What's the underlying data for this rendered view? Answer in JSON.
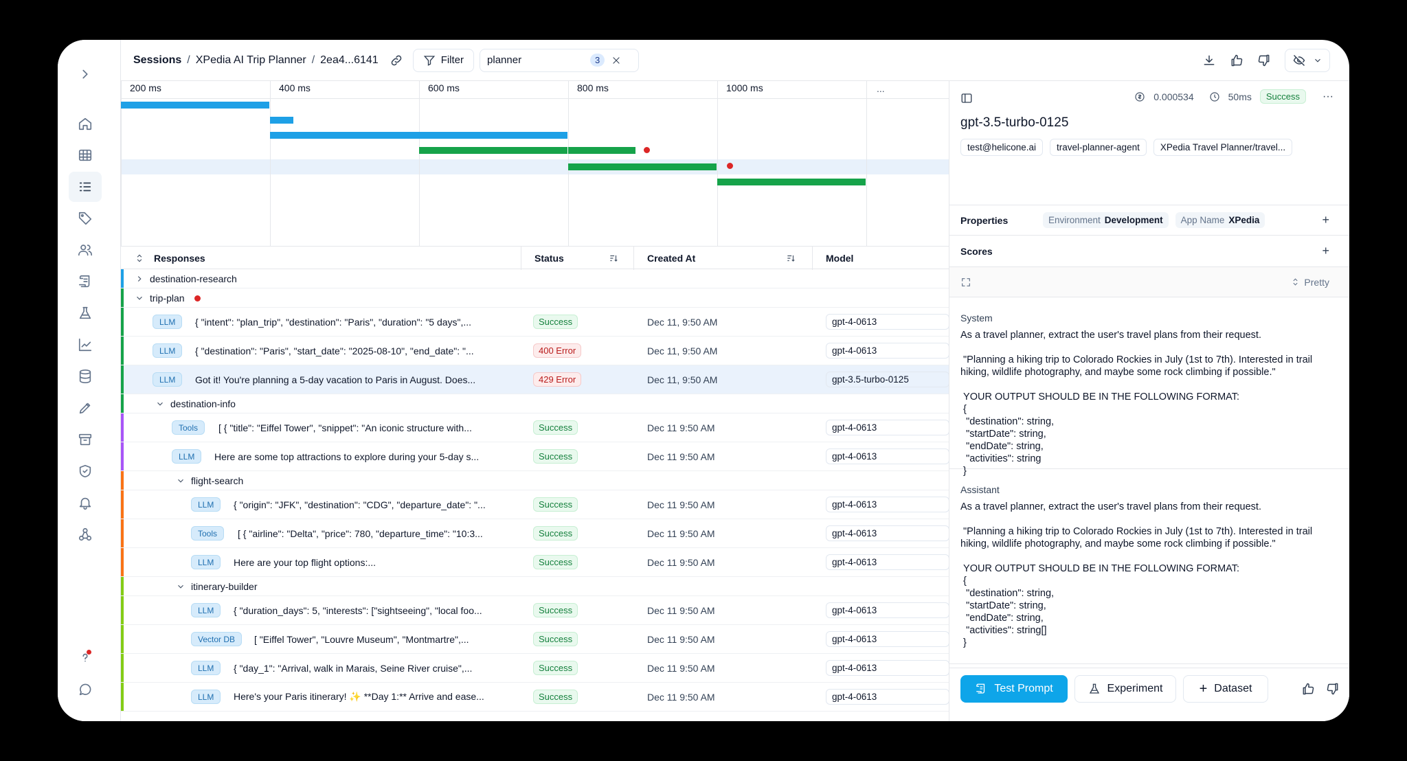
{
  "breadcrumb": {
    "sessions": "Sessions",
    "session_name": "XPedia AI Trip Planner",
    "session_id": "2ea4...6141"
  },
  "toolbar": {
    "filter_label": "Filter",
    "search_value": "planner",
    "search_count": "3"
  },
  "timeline": {
    "ticks": [
      "200 ms",
      "400 ms",
      "600 ms",
      "800 ms",
      "1000 ms"
    ],
    "more": "..."
  },
  "table": {
    "headers": {
      "responses": "Responses",
      "status": "Status",
      "created_at": "Created At",
      "model": "Model"
    },
    "groups": {
      "destination_research": "destination-research",
      "trip_plan": "trip-plan",
      "destination_info": "destination-info",
      "flight_search": "flight-search",
      "itinerary_builder": "itinerary-builder"
    },
    "rows": [
      {
        "type": "LLM",
        "response": "{ \"intent\": \"plan_trip\", \"destination\": \"Paris\", \"duration\": \"5 days\",...",
        "status": "Success",
        "created": "Dec 11, 9:50 AM",
        "model": "gpt-4-0613"
      },
      {
        "type": "LLM",
        "response": "{ \"destination\": \"Paris\", \"start_date\": \"2025-08-10\", \"end_date\": \"...",
        "status": "400 Error",
        "created": "Dec 11, 9:50 AM",
        "model": "gpt-4-0613"
      },
      {
        "type": "LLM",
        "response": "Got it! You're planning a 5-day vacation to Paris in August. Does...",
        "status": "429 Error",
        "created": "Dec 11, 9:50 AM",
        "model": "gpt-3.5-turbo-0125"
      },
      {
        "type": "Tools",
        "response": "[ { \"title\": \"Eiffel Tower\", \"snippet\": \"An iconic structure with...",
        "status": "Success",
        "created": "Dec 11 9:50 AM",
        "model": "gpt-4-0613"
      },
      {
        "type": "LLM",
        "response": "Here are some top attractions to explore during your 5-day s...",
        "status": "Success",
        "created": "Dec 11 9:50 AM",
        "model": "gpt-4-0613"
      },
      {
        "type": "LLM",
        "response": "{ \"origin\": \"JFK\", \"destination\": \"CDG\", \"departure_date\": \"...",
        "status": "Success",
        "created": "Dec 11 9:50 AM",
        "model": "gpt-4-0613"
      },
      {
        "type": "Tools",
        "response": "[ { \"airline\": \"Delta\", \"price\": 780, \"departure_time\": \"10:3...",
        "status": "Success",
        "created": "Dec 11 9:50 AM",
        "model": "gpt-4-0613"
      },
      {
        "type": "LLM",
        "response": "Here are your top flight options:...",
        "status": "Success",
        "created": "Dec 11 9:50 AM",
        "model": "gpt-4-0613"
      },
      {
        "type": "LLM",
        "response": "{ \"duration_days\": 5, \"interests\": [\"sightseeing\", \"local foo...",
        "status": "Success",
        "created": "Dec 11 9:50 AM",
        "model": "gpt-4-0613"
      },
      {
        "type": "Vector DB",
        "response": "[ \"Eiffel Tower\", \"Louvre Museum\", \"Montmartre\",...",
        "status": "Success",
        "created": "Dec 11 9:50 AM",
        "model": "gpt-4-0613"
      },
      {
        "type": "LLM",
        "response": "{ \"day_1\": \"Arrival, walk in Marais, Seine River cruise\",...",
        "status": "Success",
        "created": "Dec 11 9:50 AM",
        "model": "gpt-4-0613"
      },
      {
        "type": "LLM",
        "response": "Here's your Paris itinerary! ✨ **Day 1:** Arrive and ease...",
        "status": "Success",
        "created": "Dec 11 9:50 AM",
        "model": "gpt-4-0613"
      }
    ]
  },
  "detail": {
    "cost": "0.000534",
    "latency": "50ms",
    "status": "Success",
    "model": "gpt-3.5-turbo-0125",
    "tags": [
      "test@helicone.ai",
      "travel-planner-agent",
      "XPedia Travel Planner/travel..."
    ],
    "properties_label": "Properties",
    "properties": [
      {
        "key": "Environment",
        "value": "Development"
      },
      {
        "key": "App Name",
        "value": "XPedia"
      }
    ],
    "scores_label": "Scores",
    "pretty_label": "Pretty",
    "messages": [
      {
        "role": "System",
        "text": "As a travel planner, extract the user's travel plans from their request.\n\n \"Planning a hiking trip to Colorado Rockies in July (1st to 7th). Interested in trail hiking, wildlife photography, and maybe some rock climbing if possible.\"\n\n YOUR OUTPUT SHOULD BE IN THE FOLLOWING FORMAT:\n {\n  \"destination\": string,\n  \"startDate\": string,\n  \"endDate\": string,\n  \"activities\": string\n }"
      },
      {
        "role": "Assistant",
        "text": "As a travel planner, extract the user's travel plans from their request.\n\n \"Planning a hiking trip to Colorado Rockies in July (1st to 7th). Interested in trail hiking, wildlife photography, and maybe some rock climbing if possible.\"\n\n YOUR OUTPUT SHOULD BE IN THE FOLLOWING FORMAT:\n {\n  \"destination\": string,\n  \"startDate\": string,\n  \"endDate\": string,\n  \"activities\": string[]\n }"
      },
      {
        "role": "Assistant",
        "text": ""
      }
    ],
    "buttons": {
      "test_prompt": "Test Prompt",
      "experiment": "Experiment",
      "dataset": "Dataset"
    }
  },
  "colors": {
    "accent": "#0ea5e9",
    "bar_blue": "#1ea0e6",
    "bar_green": "#16a34a",
    "error_red": "#dc2626"
  }
}
